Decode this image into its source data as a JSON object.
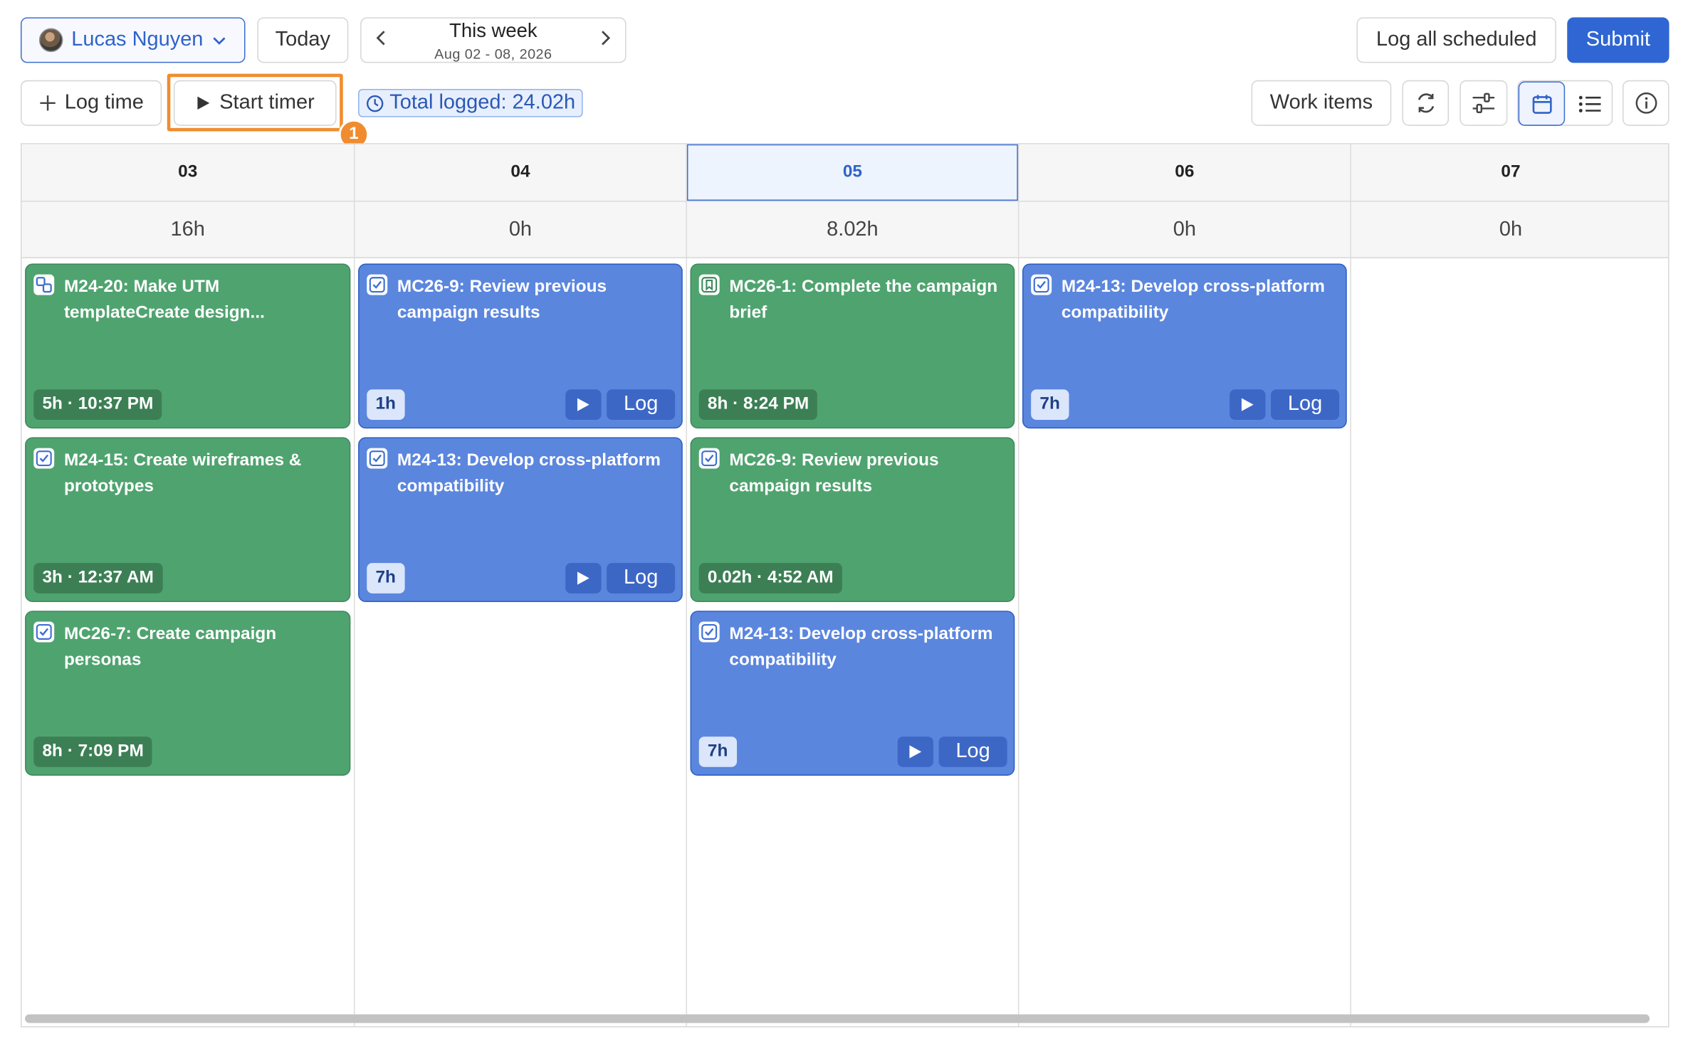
{
  "header": {
    "user_name": "Lucas Nguyen",
    "today_label": "Today",
    "week_title": "This week",
    "week_range": "Aug 02 - 08, 2026",
    "log_all_label": "Log all scheduled",
    "submit_label": "Submit"
  },
  "toolbar": {
    "log_time_label": "Log time",
    "start_timer_label": "Start timer",
    "highlight_badge": "1",
    "total_logged": "Total logged: 24.02h",
    "work_items_label": "Work items"
  },
  "colors": {
    "accent": "#2f66d3",
    "green_card": "#4fa36f",
    "blue_card": "#5b86de",
    "highlight": "#f08c2f"
  },
  "days": [
    {
      "label": "03",
      "total": "16h",
      "current": false
    },
    {
      "label": "04",
      "total": "0h",
      "current": false
    },
    {
      "label": "05",
      "total": "8.02h",
      "current": true
    },
    {
      "label": "06",
      "total": "0h",
      "current": false
    },
    {
      "label": "07",
      "total": "0h",
      "current": false
    }
  ],
  "cards": {
    "d0": [
      {
        "title": "M24-20: Make UTM templateCreate design...",
        "time": "5h · 10:37 PM",
        "status": "logged",
        "icon": "subtask-icon"
      },
      {
        "title": "M24-15: Create wireframes & prototypes",
        "time": "3h · 12:37 AM",
        "status": "logged",
        "icon": "task-check-icon"
      },
      {
        "title": "MC26-7: Create campaign personas",
        "time": "8h · 7:09 PM",
        "status": "logged",
        "icon": "task-check-icon"
      }
    ],
    "d1": [
      {
        "title": "MC26-9: Review previous campaign results",
        "time": "1h",
        "status": "scheduled",
        "log": "Log",
        "icon": "task-check-icon"
      },
      {
        "title": "M24-13: Develop cross-platform compatibility",
        "time": "7h",
        "status": "scheduled",
        "log": "Log",
        "icon": "task-check-icon"
      }
    ],
    "d2": [
      {
        "title": "MC26-1: Complete the campaign brief",
        "time": "8h · 8:24 PM",
        "status": "logged",
        "icon": "bookmark-icon"
      },
      {
        "title": "MC26-9: Review previous campaign results",
        "time": "0.02h · 4:52 AM",
        "status": "logged",
        "icon": "task-check-icon"
      },
      {
        "title": "M24-13: Develop cross-platform compatibility",
        "time": "7h",
        "status": "scheduled",
        "log": "Log",
        "icon": "task-check-icon"
      }
    ],
    "d3": [
      {
        "title": "M24-13: Develop cross-platform compatibility",
        "time": "7h",
        "status": "scheduled",
        "log": "Log",
        "icon": "task-check-icon"
      }
    ]
  }
}
